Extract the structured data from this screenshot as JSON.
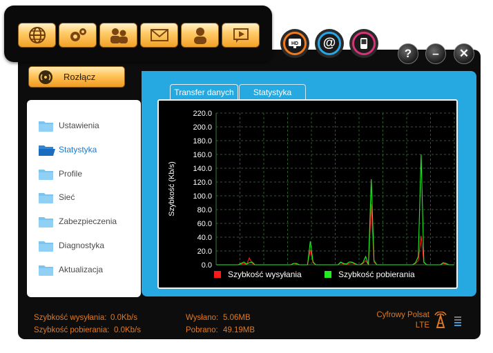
{
  "toolbar": {
    "buttons": [
      "globe-icon",
      "gears-icon",
      "users-icon",
      "envelope-icon",
      "user-icon",
      "play-icon"
    ]
  },
  "round_buttons": [
    "hd-icon",
    "at-icon",
    "phone-icon"
  ],
  "window_buttons": {
    "help": "?",
    "minimize": "–",
    "close": "✕"
  },
  "disconnect": {
    "label": "Rozłącz"
  },
  "sidebar": {
    "items": [
      {
        "label": "Ustawienia"
      },
      {
        "label": "Statystyka",
        "active": true
      },
      {
        "label": "Profile"
      },
      {
        "label": "Sieć"
      },
      {
        "label": "Zabezpieczenia"
      },
      {
        "label": "Diagnostyka"
      },
      {
        "label": "Aktualizacja"
      }
    ]
  },
  "tabs": [
    {
      "label": "Transfer danych",
      "active": true
    },
    {
      "label": "Statystyka"
    }
  ],
  "chart_data": {
    "type": "line",
    "ylabel": "Szybkość (Kb/s)",
    "ylim": [
      0,
      220
    ],
    "yticks": [
      "220.0",
      "200.0",
      "180.0",
      "160.0",
      "140.0",
      "120.0",
      "100.0",
      "80.0",
      "60.0",
      "40.0",
      "20.0",
      "0.0"
    ],
    "grid": true,
    "legend_position": "bottom",
    "series": [
      {
        "name": "Szybkość wysyłania",
        "color": "#ff1a1a",
        "values": [
          0,
          0,
          0,
          0,
          0,
          0,
          0,
          0,
          0,
          1,
          2,
          0,
          10,
          2,
          0,
          0,
          0,
          0,
          0,
          0,
          0,
          0,
          0,
          0,
          0,
          0,
          0,
          0,
          2,
          1,
          0,
          0,
          0,
          0,
          22,
          3,
          0,
          0,
          0,
          0,
          0,
          0,
          0,
          0,
          0,
          3,
          1,
          0,
          2,
          3,
          1,
          0,
          0,
          2,
          6,
          0,
          88,
          4,
          0,
          0,
          0,
          0,
          0,
          0,
          0,
          0,
          0,
          0,
          0,
          0,
          0,
          0,
          2,
          6,
          42,
          3,
          0,
          0,
          0,
          0,
          0,
          0,
          2,
          1,
          0,
          0,
          0
        ]
      },
      {
        "name": "Szybkość pobierania",
        "color": "#22ee22",
        "values": [
          0,
          0,
          0,
          0,
          0,
          0,
          0,
          0,
          0,
          2,
          4,
          1,
          3,
          4,
          0,
          0,
          0,
          0,
          0,
          0,
          0,
          0,
          0,
          0,
          0,
          0,
          0,
          0,
          2,
          2,
          0,
          0,
          0,
          0,
          34,
          4,
          0,
          0,
          0,
          0,
          0,
          0,
          0,
          0,
          0,
          4,
          2,
          1,
          4,
          4,
          2,
          0,
          0,
          3,
          12,
          0,
          124,
          6,
          0,
          0,
          0,
          0,
          0,
          0,
          0,
          0,
          0,
          0,
          0,
          0,
          0,
          0,
          3,
          12,
          160,
          4,
          0,
          0,
          0,
          0,
          0,
          0,
          3,
          2,
          0,
          0,
          0
        ]
      }
    ]
  },
  "status": {
    "upload_speed_label": "Szybkość wysyłania:",
    "upload_speed_value": "0.0Kb/s",
    "download_speed_label": "Szybkość pobierania:",
    "download_speed_value": "0.0Kb/s",
    "sent_label": "Wysłano:",
    "sent_value": "5.06MB",
    "received_label": "Pobrano:",
    "received_value": "49.19MB",
    "operator": "Cyfrowy Polsat",
    "network": "LTE"
  },
  "colors": {
    "accent_blue": "#25a9e0",
    "status_orange": "#e07a22",
    "button_orange": "#ffc45a"
  }
}
